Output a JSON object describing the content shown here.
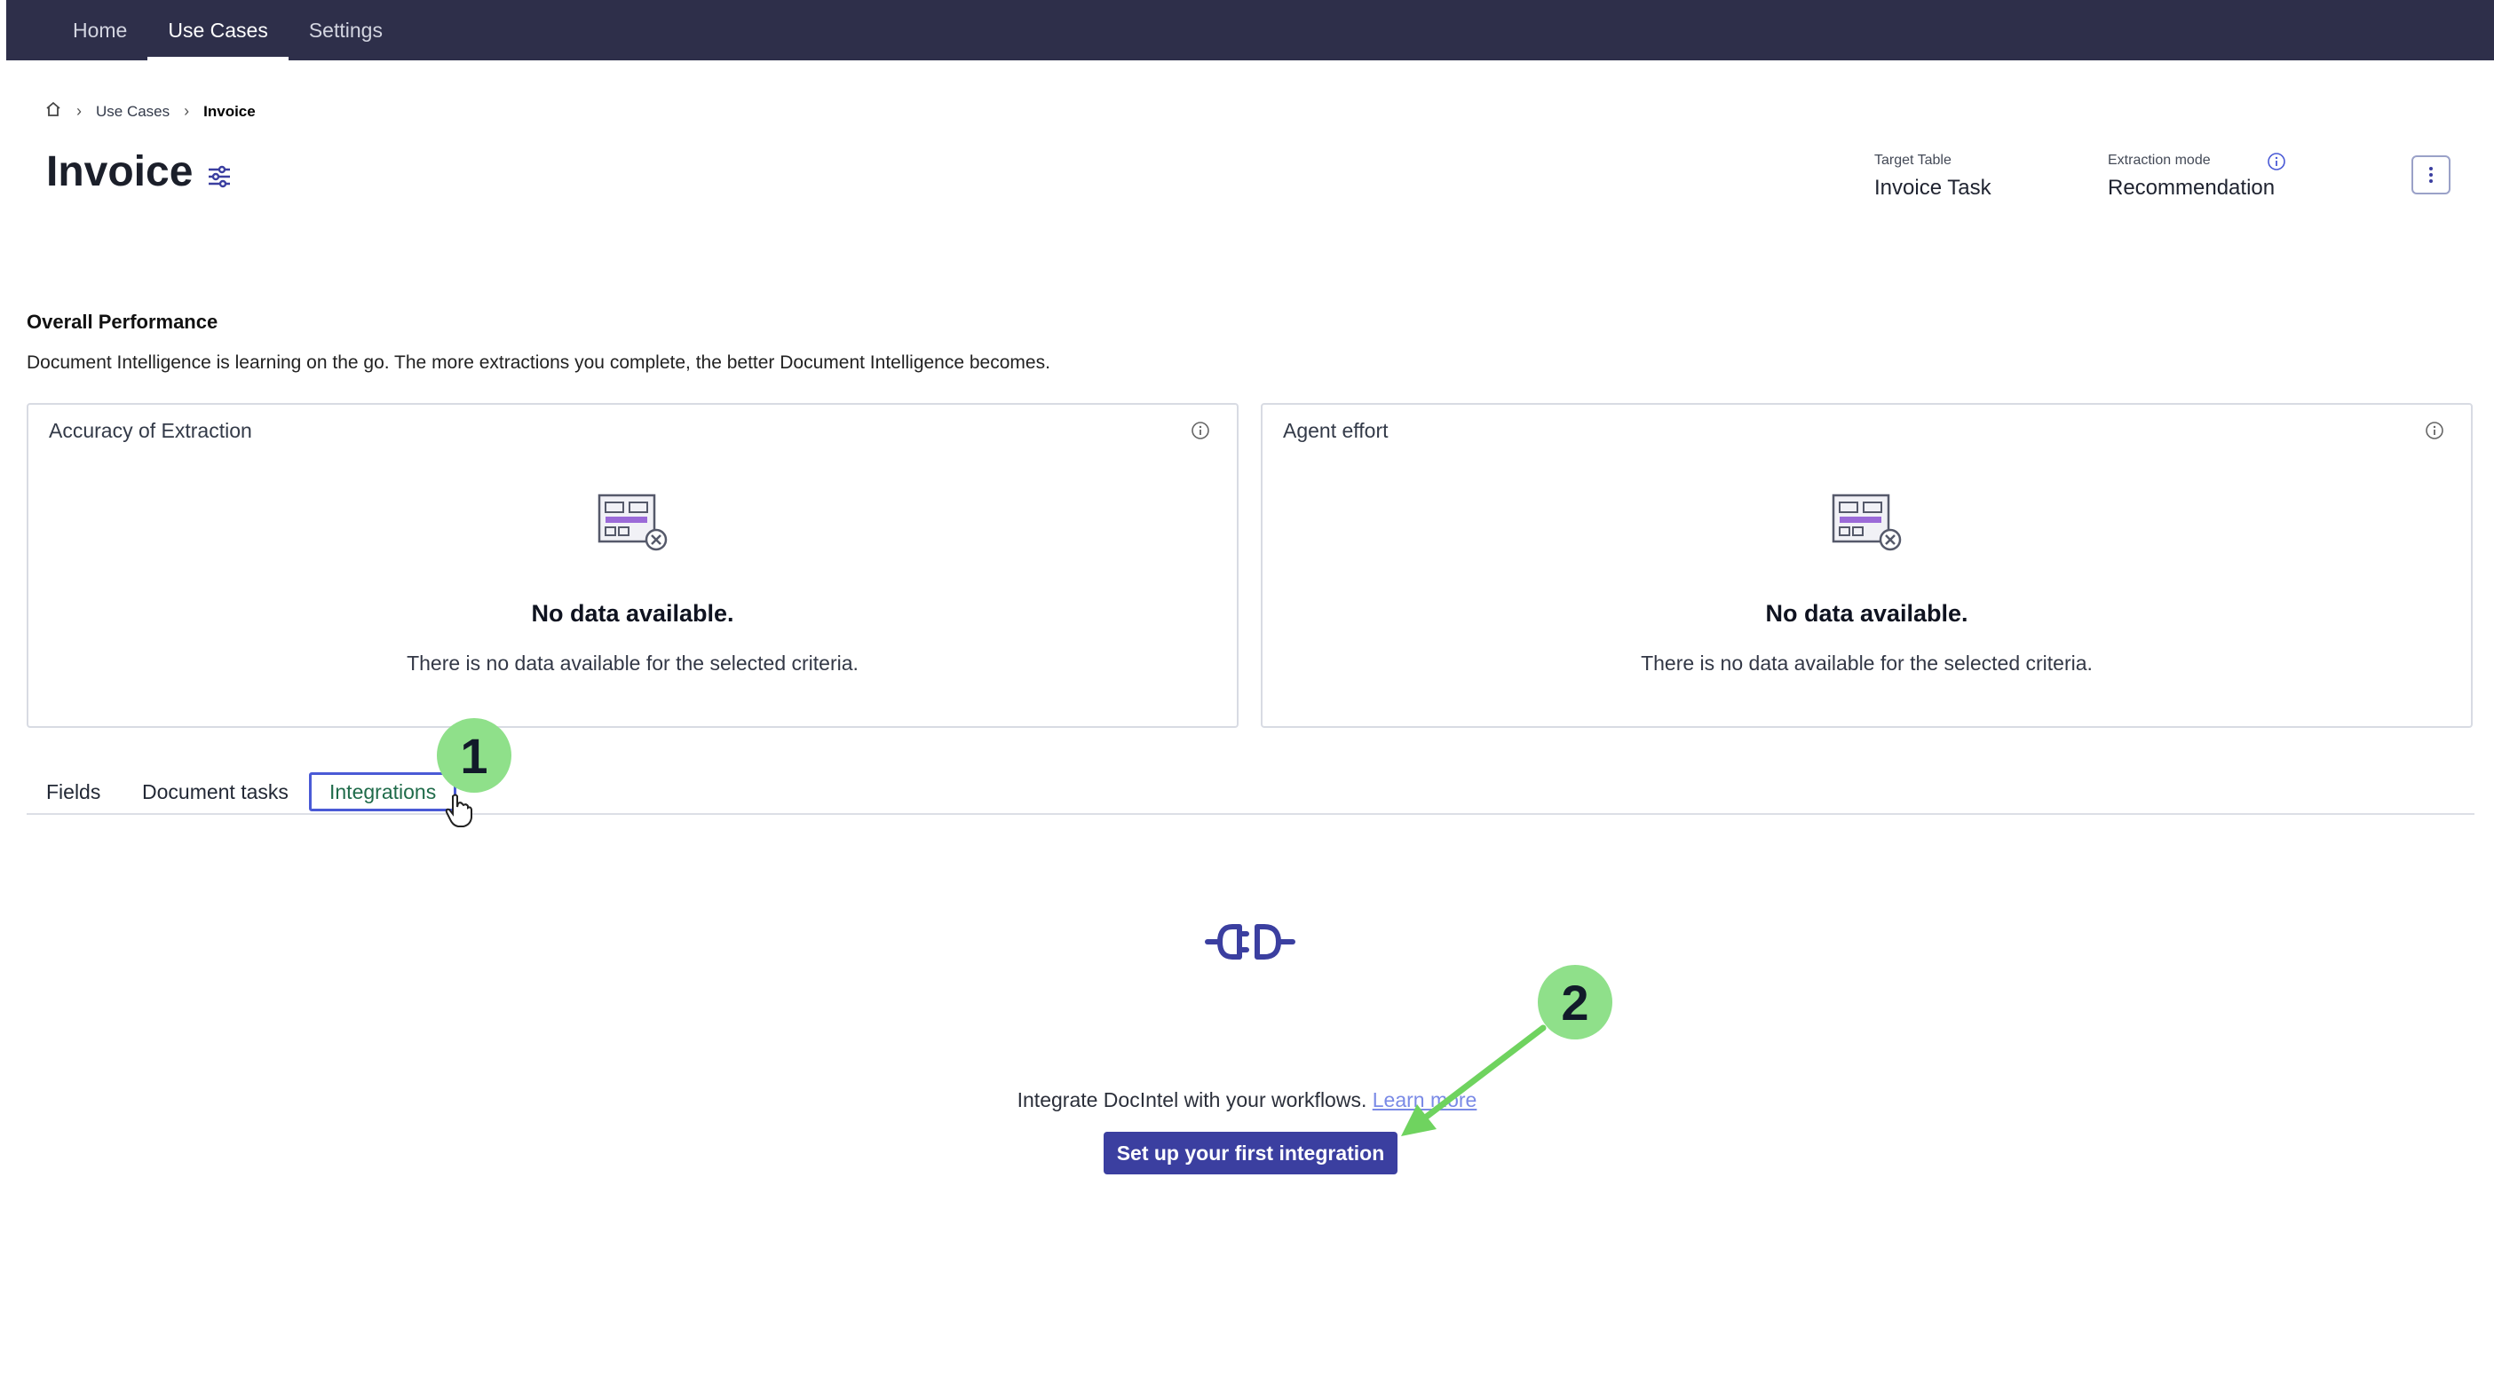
{
  "nav": {
    "items": [
      {
        "label": "Home"
      },
      {
        "label": "Use Cases"
      },
      {
        "label": "Settings"
      }
    ]
  },
  "breadcrumb": {
    "home_icon": "home-icon",
    "items": [
      "Use Cases",
      "Invoice"
    ]
  },
  "page": {
    "title": "Invoice",
    "target_table_label": "Target Table",
    "target_table_value": "Invoice Task",
    "extraction_mode_label": "Extraction mode",
    "extraction_mode_value": "Recommendation"
  },
  "performance": {
    "title": "Overall Performance",
    "description": "Document Intelligence is learning on the go. The more extractions you complete, the better Document Intelligence becomes.",
    "cards": [
      {
        "title": "Accuracy of Extraction",
        "empty_title": "No data available.",
        "empty_desc": "There is no data available for the selected criteria."
      },
      {
        "title": "Agent effort",
        "empty_title": "No data available.",
        "empty_desc": "There is no data available for the selected criteria."
      }
    ]
  },
  "tabs": [
    "Fields",
    "Document tasks",
    "Integrations"
  ],
  "integrations": {
    "prompt": "Integrate DocIntel with your workflows.",
    "learn_more": "Learn more",
    "cta": "Set up your first integration"
  },
  "annotations": {
    "step1": "1",
    "step2": "2"
  },
  "colors": {
    "nav_bg": "#2e2f4a",
    "accent": "#3b3fa0",
    "callout": "#8fe08a",
    "arrow": "#6fd35f"
  }
}
